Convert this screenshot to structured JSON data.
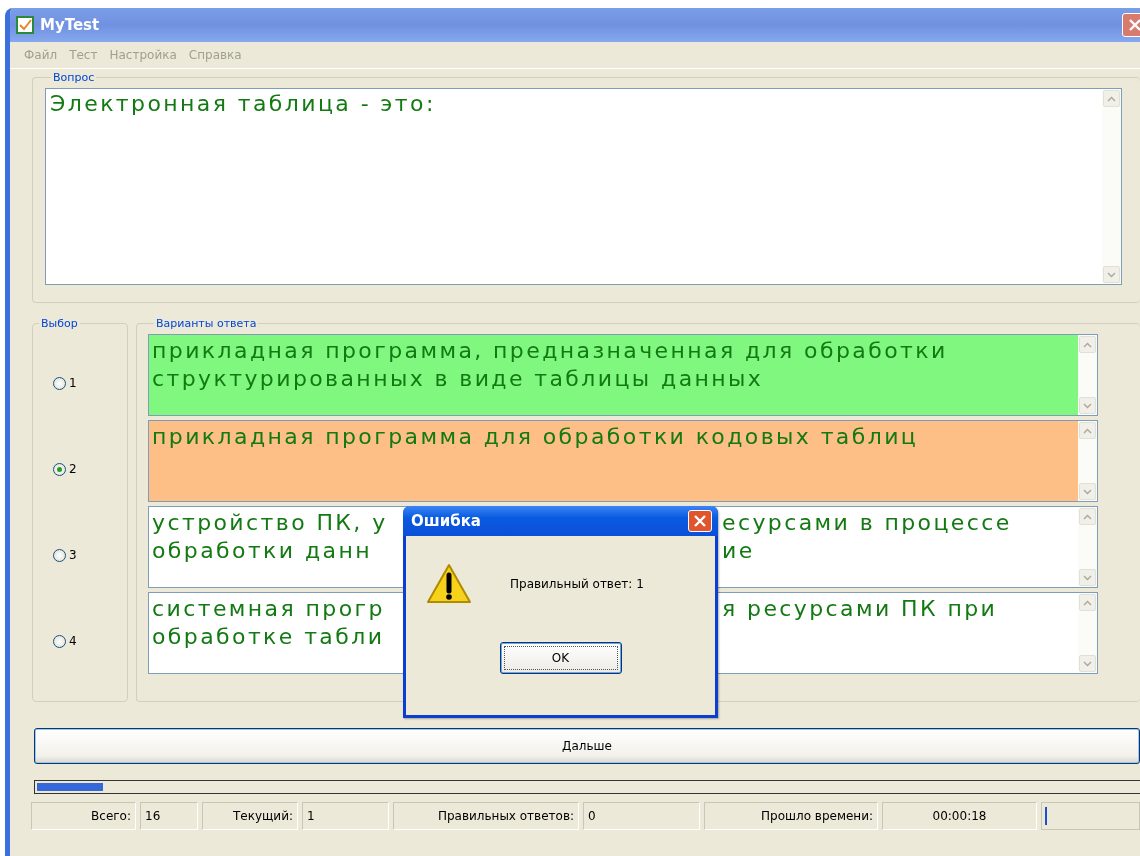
{
  "window": {
    "title": "MyTest"
  },
  "menu": [
    {
      "label": "Файл",
      "disabled": true
    },
    {
      "label": "Тест",
      "disabled": true
    },
    {
      "label": "Настройка",
      "disabled": true
    },
    {
      "label": "Справка",
      "disabled": true
    }
  ],
  "question_group": {
    "label": "Вопрос",
    "text": "Электронная таблица - это:"
  },
  "choice_group": {
    "label": "Выбор",
    "options": [
      {
        "label": "1",
        "selected": false
      },
      {
        "label": "2",
        "selected": true
      },
      {
        "label": "3",
        "selected": false
      },
      {
        "label": "4",
        "selected": false
      }
    ]
  },
  "answers_group": {
    "label": "Варианты ответа",
    "answers": [
      {
        "color": "#80f880",
        "lines": [
          [
            "прикладная программа, предназначенная для обработки"
          ],
          [
            "структурированных в виде таблицы данных"
          ]
        ]
      },
      {
        "color": "#fdbf86",
        "lines": [
          [
            "прикладная программа для обработки кодовых таблиц"
          ]
        ]
      },
      {
        "color": "#ffffff",
        "lines": [
          [
            "устройство ПК, у",
            "есурсами в процессе"
          ],
          [
            "обработки данн",
            "ие"
          ]
        ]
      },
      {
        "color": "#ffffff",
        "lines": [
          [
            "системная прогр",
            "я ресурсами ПК при"
          ],
          [
            "обработке табли"
          ]
        ]
      }
    ]
  },
  "next_button": "Дальше",
  "progress": {
    "level": 0.06
  },
  "status_bar": [
    {
      "label": "Всего:",
      "value": "16"
    },
    {
      "label": "Текущий:",
      "value": "1"
    },
    {
      "label": "Правильных ответов:",
      "value": "0"
    },
    {
      "label": "Прошло времени:",
      "value": "00:00:18"
    }
  ],
  "status_progress": {
    "level": 0.02
  },
  "dialog": {
    "title": "Ошибка",
    "message": "Правильный ответ: 1",
    "button": "OK"
  }
}
